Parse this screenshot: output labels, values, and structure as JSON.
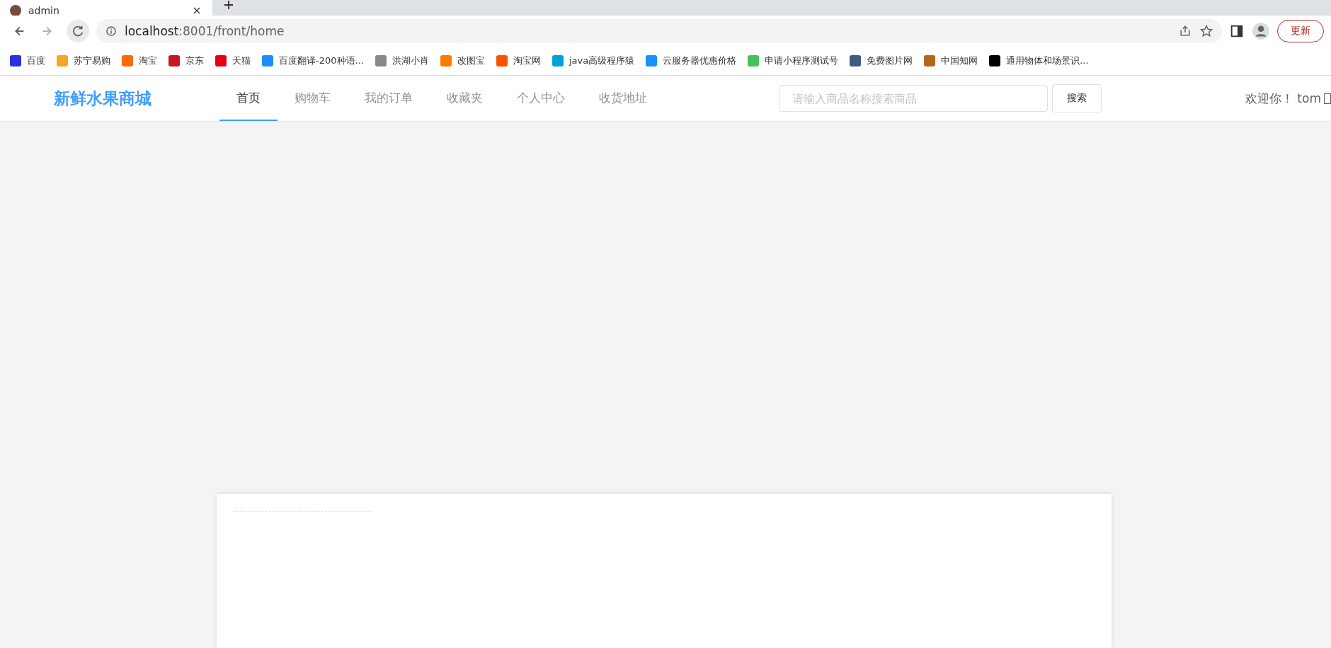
{
  "browser": {
    "tab": {
      "title": "admin"
    },
    "address": {
      "host": "localhost",
      "path": ":8001/front/home"
    },
    "update_button": "更新",
    "bookmarks": [
      {
        "label": "百度"
      },
      {
        "label": "苏宁易购"
      },
      {
        "label": "淘宝"
      },
      {
        "label": "京东"
      },
      {
        "label": "天猫"
      },
      {
        "label": "百度翻译-200种语..."
      },
      {
        "label": "洪湖小肖"
      },
      {
        "label": "改图宝"
      },
      {
        "label": "淘宝网"
      },
      {
        "label": "java高级程序猿"
      },
      {
        "label": "云服务器优惠价格"
      },
      {
        "label": "申请小程序测试号"
      },
      {
        "label": "免费图片网"
      },
      {
        "label": "中国知网"
      },
      {
        "label": "通用物体和场景识..."
      }
    ]
  },
  "header": {
    "logo": "新鲜水果商城",
    "nav": [
      {
        "label": "首页",
        "selected": true
      },
      {
        "label": "购物车",
        "selected": false
      },
      {
        "label": "我的订单",
        "selected": false
      },
      {
        "label": "收藏夹",
        "selected": false
      },
      {
        "label": "个人中心",
        "selected": false
      },
      {
        "label": "收货地址",
        "selected": false
      }
    ],
    "search": {
      "placeholder": "请输入商品名称搜索商品",
      "button": "搜索"
    },
    "welcome": "欢迎你！ tom"
  }
}
